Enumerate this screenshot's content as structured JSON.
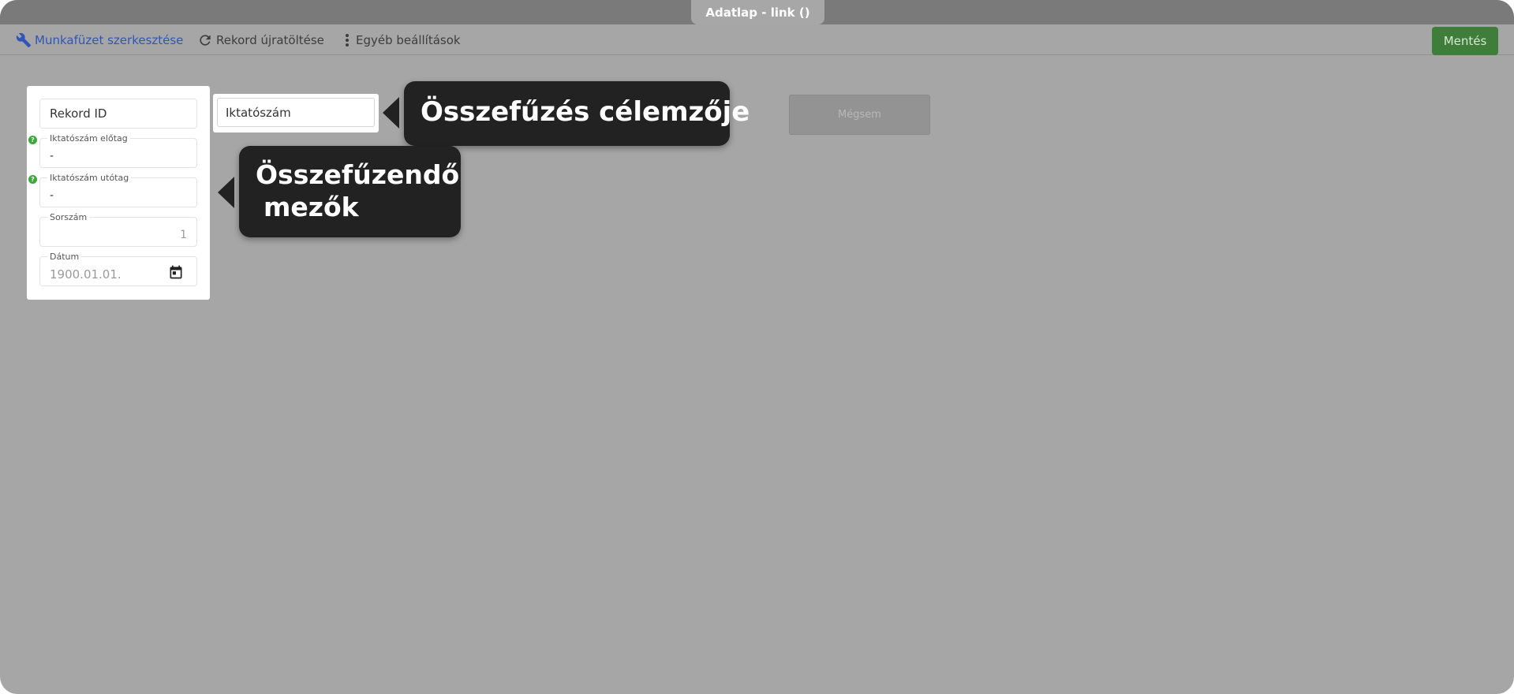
{
  "window": {
    "title": "Adatlap - link ()"
  },
  "toolbar": {
    "workbook_label": "Munkafüzet szerkesztése",
    "reload_label": "Rekord újratöltése",
    "other_label": "Egyéb beállítások",
    "save_label": "Mentés"
  },
  "form": {
    "record_id": {
      "label": "Rekord ID"
    },
    "prefix": {
      "label": "Iktatószám előtag",
      "value": "-",
      "help": "?"
    },
    "suffix": {
      "label": "Iktatószám utótag",
      "value": "-",
      "help": "?"
    },
    "serial": {
      "label": "Sorszám",
      "value": "1"
    },
    "date": {
      "label": "Dátum",
      "value": "1900.01.01."
    }
  },
  "target": {
    "label": "Iktatószám"
  },
  "cancel_label": "Mégsem",
  "callouts": {
    "target_title": "Összefűzés célemzője",
    "fields_line1": "Összefűzendő",
    "fields_line2": "mezők"
  },
  "colors": {
    "accent_link": "#2f55b8",
    "save_green": "#3f7d3a",
    "help_green": "#3aa93a",
    "callout_bg": "#222222"
  }
}
